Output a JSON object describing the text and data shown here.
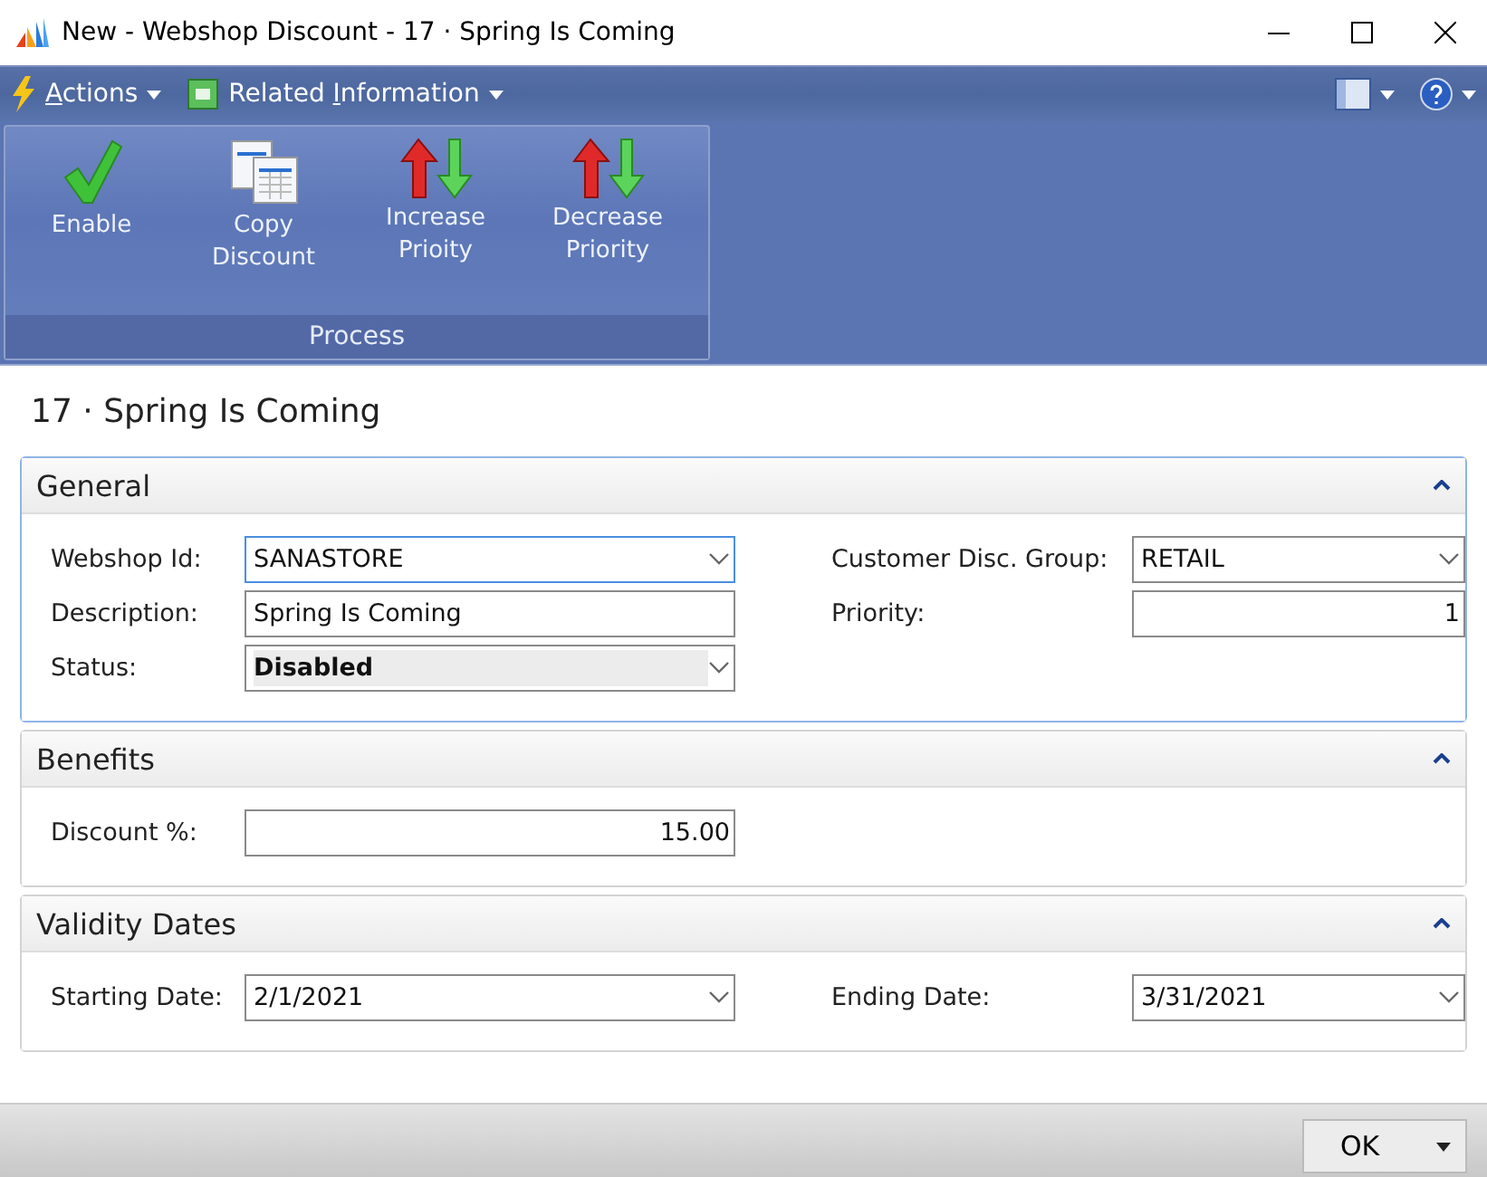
{
  "window": {
    "title": "New - Webshop Discount - 17 · Spring Is Coming"
  },
  "menu": [
    {
      "kind": "actions",
      "key": "A",
      "rest": "ctions"
    },
    {
      "kind": "related",
      "prefix": "Related ",
      "key": "I",
      "rest": "nformation"
    }
  ],
  "ribbon": {
    "group": "Process",
    "actions": [
      {
        "kind": "check",
        "label": "Enable"
      },
      {
        "kind": "copy",
        "label": "Copy Discount"
      },
      {
        "kind": "updown",
        "label": "Increase Prioity"
      },
      {
        "kind": "updown",
        "label": "Decrease Priority"
      }
    ]
  },
  "page_title": "17 · Spring Is Coming",
  "sections": [
    {
      "title": "General",
      "expanded": true,
      "focused": true,
      "columns": [
        [
          {
            "label": "Webshop Id:",
            "value": "SANASTORE",
            "kind": "dropdown",
            "focused": true
          },
          {
            "label": "Description:",
            "value": "Spring Is Coming",
            "kind": "text"
          },
          {
            "label": "Status:",
            "value": "Disabled",
            "kind": "option"
          }
        ],
        [
          {
            "label": "Customer Disc. Group:",
            "value": "RETAIL",
            "kind": "dropdown"
          },
          {
            "label": "Priority:",
            "value": "1",
            "kind": "number"
          }
        ]
      ]
    },
    {
      "title": "Benefits",
      "expanded": true,
      "focused": false,
      "columns": [
        [
          {
            "label": "Discount %:",
            "value": "15.00",
            "kind": "number"
          }
        ]
      ]
    },
    {
      "title": "Validity Dates",
      "expanded": true,
      "focused": false,
      "columns": [
        [
          {
            "label": "Starting Date:",
            "value": "2/1/2021",
            "kind": "date"
          }
        ],
        [
          {
            "label": "Ending Date:",
            "value": "3/31/2021",
            "kind": "date"
          }
        ]
      ]
    }
  ],
  "footer": {
    "ok": "OK"
  }
}
